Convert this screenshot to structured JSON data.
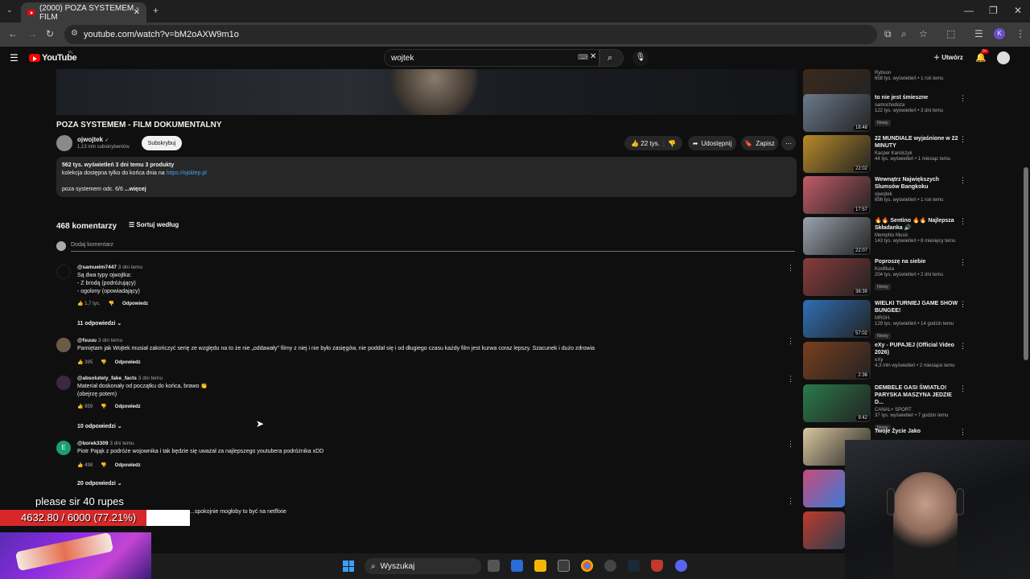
{
  "browser": {
    "tab_title": "(2000) POZA SYSTEMEM - FILM",
    "url": "youtube.com/watch?v=bM2oAXW9m1o",
    "profile_initial": "K"
  },
  "youtube": {
    "logo": "YouTube",
    "region": "PL",
    "search_value": "wojtek",
    "create_label": "Utwórz",
    "notif_count": "9+"
  },
  "video": {
    "title": "POZA SYSTEMEM - FILM DOKUMENTALNY",
    "channel": "ojwojtek",
    "subscribers": "1,13 mln subskrybentów",
    "subscribe_label": "Subskrybuj",
    "likes": "22 tys.",
    "share_label": "Udostępnij",
    "save_label": "Zapisz",
    "desc_stats": "562 tys. wyświetleń  3 dni temu  3 produkty",
    "desc_line2": "kolekcja dostępna tylko do końca dnia na ",
    "desc_link": "https://ojsklep.pl",
    "desc_line3": "poza systemem odc. 6/6",
    "desc_more": "...więcej"
  },
  "comments_section": {
    "count_label": "468 komentarzy",
    "sort_label": "Sortuj według",
    "add_placeholder": "Dodaj komentarz",
    "reply_label": "Odpowiedz",
    "comments": [
      {
        "user": "@samuelm7447",
        "time": "3 dni temu",
        "text": "Są dwa typy ojwojtka:\n- Z brodą (podróżujący)\n- ogolony (opowiadający)",
        "likes": "1,7 tys.",
        "replies": "11 odpowiedzi"
      },
      {
        "user": "@fsuuu",
        "time": "3 dni temu",
        "text": "Pamiętam jak Wojtek musiał zakończyć serię ze względu na to że nie „oddawały\" filmy z niej i nie było zasięgów, nie poddał się i od długiego czasu każdy film jest kurwa coraz lepszy. Szacunek i dużo zdrowia",
        "likes": "395",
        "replies": ""
      },
      {
        "user": "@absolutely_fake_facts",
        "time": "3 dni temu",
        "text": "Materiał doskonały od początku do końca, brawo 👏\n(obejrzę potem)",
        "likes": "959",
        "replies": "10 odpowiedzi"
      },
      {
        "user": "@borek3309",
        "time": "3 dni temu",
        "text": "Piotr Pająk z podróże wojownika i tak będzie się uważał za najlepszego youtubera podróżnika xDD",
        "likes": "498",
        "replies": "20 odpowiedzi"
      },
      {
        "user": "",
        "time": "",
        "text": "...spokojnie mogłoby to być na netflixie",
        "likes": "",
        "replies": ""
      }
    ]
  },
  "recommendations": [
    {
      "title": "",
      "channel": "Rybson",
      "meta": "658 tys. wyświetleń • 1 rok temu",
      "duration": "55:51",
      "new": "",
      "color": "#3a2a1e"
    },
    {
      "title": "to nie jest śmieszne",
      "channel": "samochodoza",
      "meta": "122 tys. wyświetleń • 3 dni temu",
      "duration": "18:48",
      "new": "Nowy",
      "color": "#6b7a8a"
    },
    {
      "title": "22 MUNDIALE wyjaśnione w 22 MINUTY",
      "channel": "Kacper Karolczyk",
      "meta": "44 tys. wyświetleń • 1 miesiąc temu",
      "duration": "22:02",
      "new": "",
      "color": "#b88a2a"
    },
    {
      "title": "Wewnątrz Największych Slumsów Bangkoku",
      "channel": "ojwojtek",
      "meta": "856 tys. wyświetleń • 1 rok temu",
      "duration": "17:57",
      "new": "",
      "color": "#c25c68"
    },
    {
      "title": "🔥🔥 Sentino 🔥🔥 Najlepsza Składanka 🔊",
      "channel": "Memphis Music",
      "meta": "143 tys. wyświetleń • 8 miesięcy temu",
      "duration": "22:07",
      "new": "",
      "color": "#9aa3ad"
    },
    {
      "title": "Poproszę na siebie",
      "channel": "Konfitura",
      "meta": "204 tys. wyświetleń • 2 dni temu",
      "duration": "38:39",
      "new": "Nowy",
      "color": "#8a3b3b"
    },
    {
      "title": "WIELKI TURNIEJ GAME SHOW BUNGEE!",
      "channel": "MRGH.",
      "meta": "129 tys. wyświetleń • 14 godzin temu",
      "duration": "57:02",
      "new": "Nowy",
      "color": "#2f6fb5"
    },
    {
      "title": "eXy - PUPAJEJ (Official Video 2026)",
      "channel": "eXy",
      "meta": "4,3 mln wyświetleń • 2 miesiące temu",
      "duration": "2:36",
      "new": "",
      "color": "#7a3f1e"
    },
    {
      "title": "DEMBELE GASI ŚWIATŁO! PARYSKA MASZYNA JEDZIE D...",
      "channel": "CANAL+ SPORT",
      "meta": "37 tys. wyświetleń • 7 godzin temu",
      "duration": "9:42",
      "new": "Nowy",
      "color": "#2b7a4a"
    },
    {
      "title": "Twoje Życie Jako",
      "channel": "",
      "meta": "",
      "duration": "",
      "new": "",
      "color": "#d9c7a0"
    }
  ],
  "overlay": {
    "donation": "please sir 40 rupes",
    "goal_text": "4632.80 / 6000 (77.21%)",
    "goal_fraction": 0.7721
  },
  "taskbar": {
    "search_label": "Wyszukaj"
  }
}
